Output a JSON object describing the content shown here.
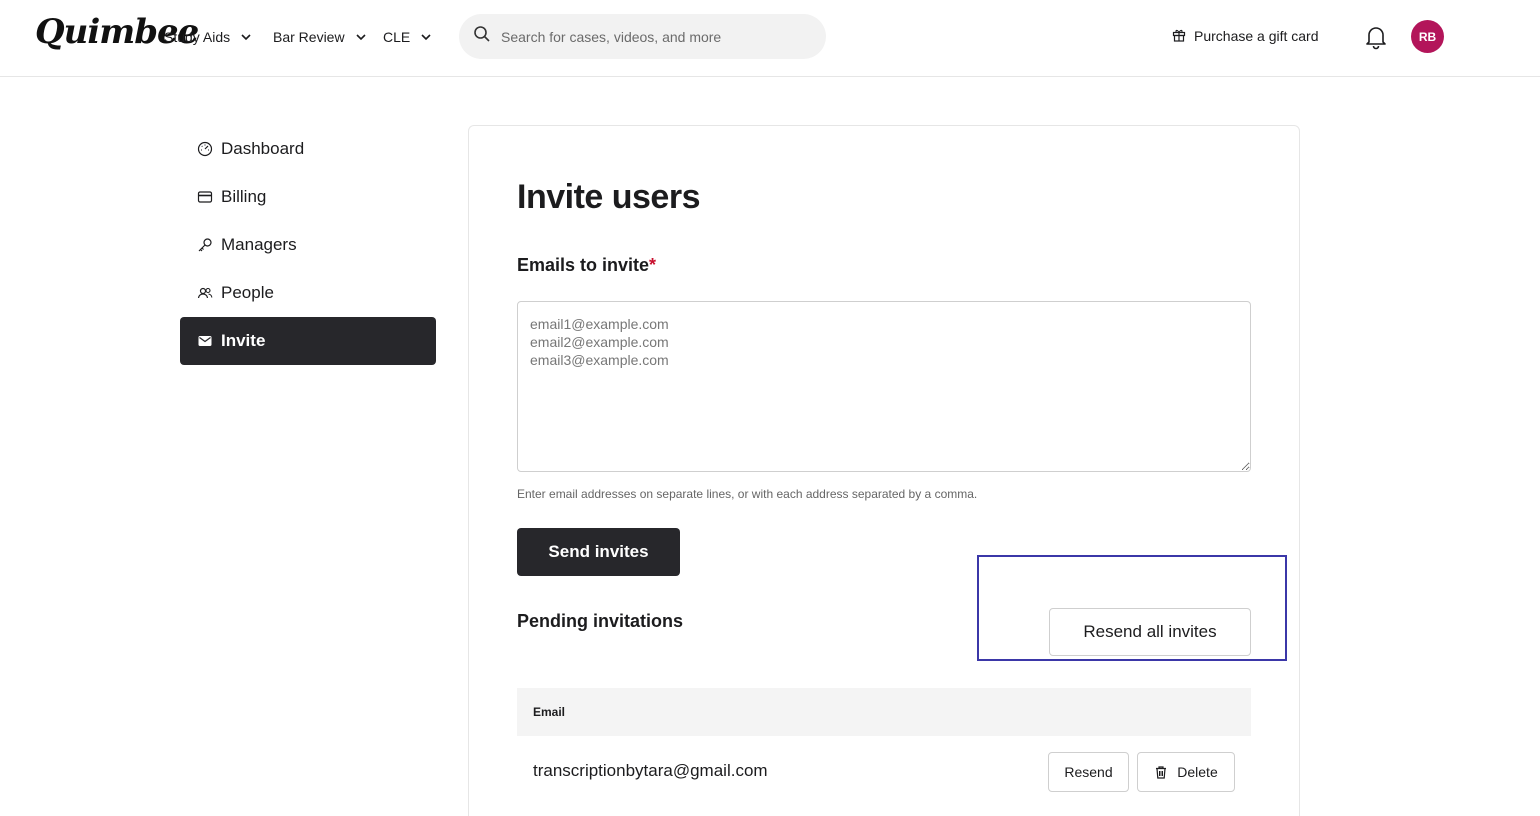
{
  "header": {
    "logo": "Quimbee",
    "nav": [
      {
        "label": "Study Aids"
      },
      {
        "label": "Bar Review"
      },
      {
        "label": "CLE"
      }
    ],
    "search_placeholder": "Search for cases, videos, and more",
    "gift_label": "Purchase a gift card",
    "avatar_initials": "RB"
  },
  "sidebar": {
    "items": [
      {
        "label": "Dashboard",
        "icon": "dashboard-icon"
      },
      {
        "label": "Billing",
        "icon": "credit-card-icon"
      },
      {
        "label": "Managers",
        "icon": "key-icon"
      },
      {
        "label": "People",
        "icon": "people-icon"
      },
      {
        "label": "Invite",
        "icon": "mail-icon",
        "active": true
      }
    ]
  },
  "main": {
    "title": "Invite users",
    "emails_label": "Emails to invite",
    "required_mark": "*",
    "emails_placeholder": "email1@example.com\nemail2@example.com\nemail3@example.com",
    "emails_value": "",
    "hint": "Enter email addresses on separate lines, or with each address separated by a comma.",
    "send_label": "Send invites",
    "pending_title": "Pending invitations",
    "resend_all_label": "Resend all invites",
    "table": {
      "header": "Email",
      "rows": [
        {
          "email": "transcriptionbytara@gmail.com",
          "resend_label": "Resend",
          "delete_label": "Delete"
        }
      ]
    }
  },
  "colors": {
    "avatar": "#b3155a",
    "active_nav": "#27272b",
    "primary_button": "#27272b",
    "required": "#c8102e",
    "highlight": "#3b37a8"
  }
}
